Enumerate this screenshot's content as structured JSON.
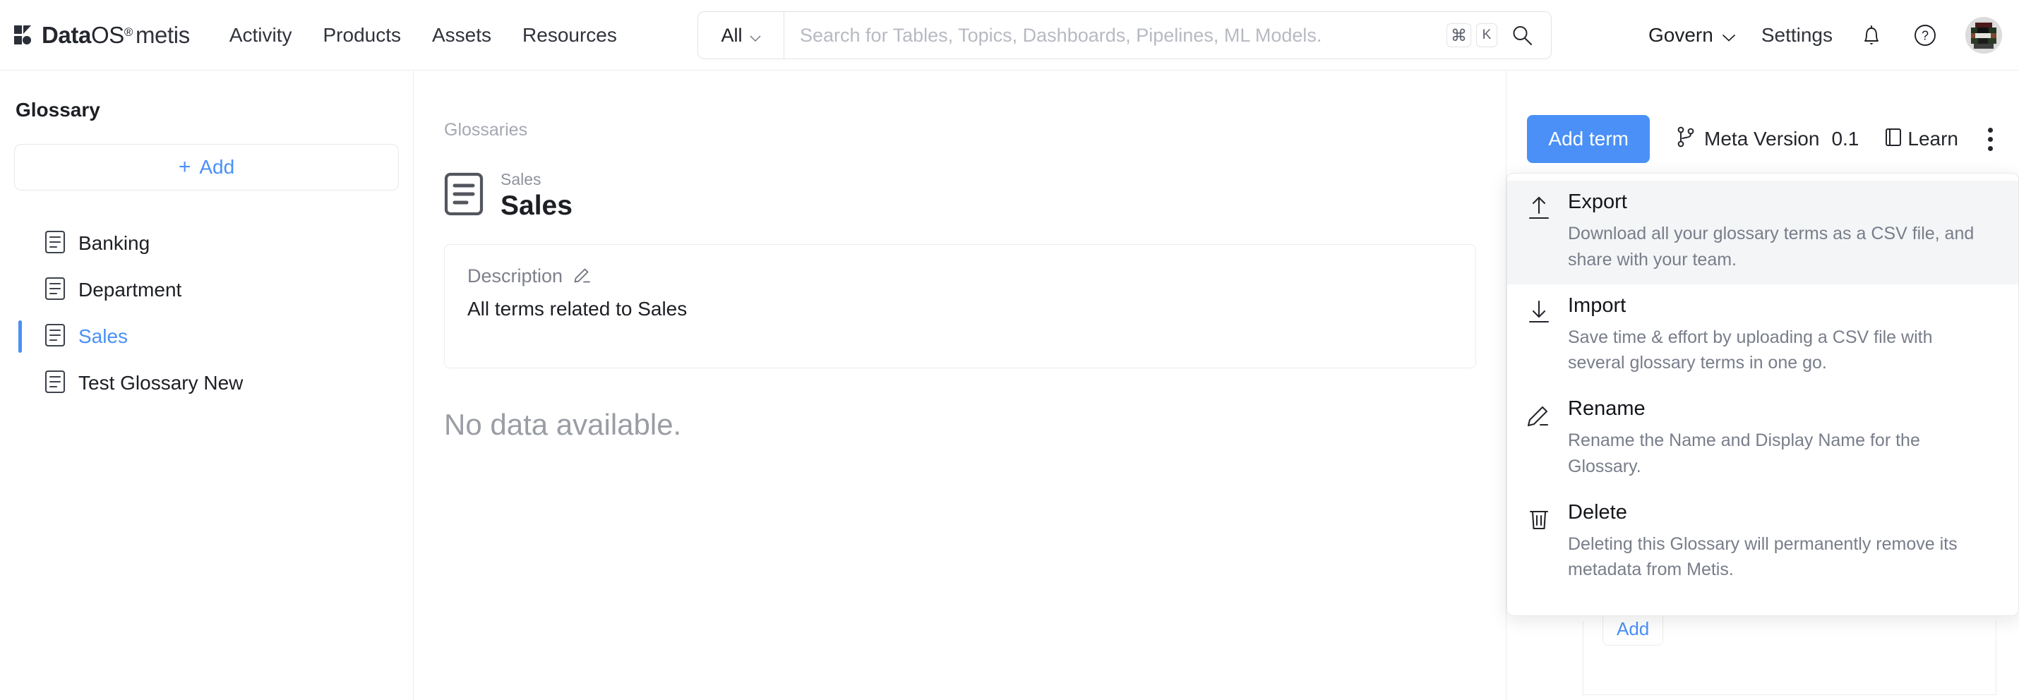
{
  "brand": {
    "name_bold": "Data",
    "name_light": "OS",
    "registered": "®",
    "product": "metis",
    "logo_icon": "dataos-logo-icon"
  },
  "nav": {
    "links": [
      {
        "label": "Activity"
      },
      {
        "label": "Products"
      },
      {
        "label": "Assets"
      },
      {
        "label": "Resources"
      }
    ]
  },
  "search": {
    "scope_label": "All",
    "scope_chevron_icon": "chevron-down-icon",
    "placeholder": "Search for Tables, Topics, Dashboards, Pipelines, ML Models.",
    "value": "",
    "shortcut_cmd": "⌘",
    "shortcut_key": "K",
    "search_icon": "search-icon"
  },
  "header_right": {
    "govern_label": "Govern",
    "govern_chevron_icon": "chevron-down-icon",
    "settings_label": "Settings",
    "notifications_icon": "bell-icon",
    "help_icon": "question-circle-icon",
    "avatar_icon": "user-avatar"
  },
  "sidebar": {
    "title": "Glossary",
    "add_button": {
      "label": "Add",
      "plus": "+"
    },
    "items": [
      {
        "label": "Banking",
        "icon": "glossary-book-icon",
        "active": false
      },
      {
        "label": "Department",
        "icon": "glossary-book-icon",
        "active": false
      },
      {
        "label": "Sales",
        "icon": "glossary-book-icon",
        "active": true
      },
      {
        "label": "Test Glossary New",
        "icon": "glossary-book-icon",
        "active": false
      }
    ]
  },
  "main": {
    "breadcrumb": "Glossaries",
    "entity_icon": "glossary-book-icon",
    "entity_name": "Sales",
    "entity_display_name": "Sales",
    "description": {
      "label": "Description",
      "edit_icon": "pencil-edit-icon",
      "text": "All terms related to Sales"
    },
    "empty_state": "No data available."
  },
  "actionbar": {
    "add_term_label": "Add term",
    "meta_version_icon": "git-branch-icon",
    "meta_version_label": "Meta Version",
    "meta_version_value": "0.1",
    "learn_icon": "book-icon",
    "learn_label": "Learn",
    "kebab_icon": "more-vertical-icon"
  },
  "right_panel": {
    "add_label": "Add"
  },
  "menu": {
    "items": [
      {
        "title": "Export",
        "desc": "Download all your glossary terms as a CSV file, and share with your team.",
        "icon": "arrow-up-export-icon",
        "hover": true
      },
      {
        "title": "Import",
        "desc": "Save time & effort by uploading a CSV file with several glossary terms in one go.",
        "icon": "arrow-down-import-icon",
        "hover": false
      },
      {
        "title": "Rename",
        "desc": "Rename the Name and Display Name for the Glossary.",
        "icon": "pencil-edit-icon",
        "hover": false
      },
      {
        "title": "Delete",
        "desc": "Deleting this Glossary will permanently remove its metadata from Metis.",
        "icon": "trash-delete-icon",
        "hover": false
      }
    ]
  },
  "colors": {
    "accent": "#4a90f7",
    "text": "#1d1f24",
    "muted": "#787d8a",
    "border": "#ededf0"
  }
}
